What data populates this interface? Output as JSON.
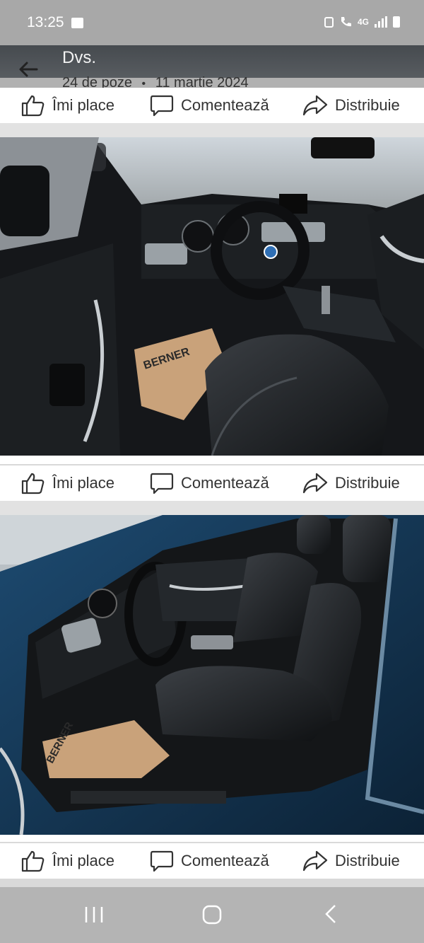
{
  "status_bar": {
    "time": "13:25",
    "network": "4G",
    "icons": [
      "gallery-icon",
      "recycle-icon",
      "wifi-call-icon",
      "signal-icon",
      "battery-icon"
    ]
  },
  "header": {
    "title": "Dvs.",
    "photo_count": "24 de poze",
    "separator": "•",
    "date": "11 martie 2024"
  },
  "actions": {
    "like": "Îmi place",
    "comment": "Comentează",
    "share": "Distribuie"
  },
  "photos": [
    {
      "subject": "driver-side interior with steering wheel and dashboard",
      "mat_text": "BERNER"
    },
    {
      "subject": "front seats seen through open driver door",
      "mat_text": "BERNER"
    }
  ],
  "colors": {
    "status_bar": "#a8a8a8",
    "action_bar": "#ffffff",
    "nav_bar": "#b4b4b4",
    "car_paint": "#163b5a",
    "leather": "#1e2124"
  }
}
